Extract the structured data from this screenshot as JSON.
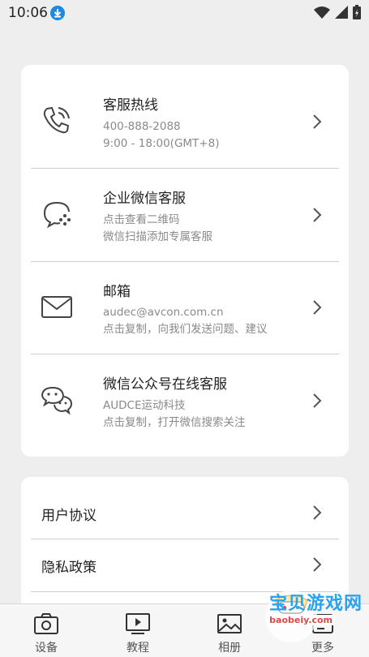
{
  "status_bar": {
    "time": "10:06"
  },
  "contact_card": {
    "items": [
      {
        "title": "客服热线",
        "line1": "400-888-2088",
        "line2": "9:00 - 18:00(GMT+8)",
        "icon": "phone-icon"
      },
      {
        "title": "企业微信客服",
        "line1": "点击查看二维码",
        "line2": "微信扫描添加专属客服",
        "icon": "wecom-icon"
      },
      {
        "title": "邮箱",
        "line1": "audec@avcon.com.cn",
        "line2": "点击复制，向我们发送问题、建议",
        "icon": "mail-icon"
      },
      {
        "title": "微信公众号在线客服",
        "line1": "AUDCE运动科技",
        "line2": "点击复制，打开微信搜索关注",
        "icon": "wechat-icon"
      }
    ]
  },
  "links_card": {
    "items": [
      {
        "title": "用户协议"
      },
      {
        "title": "隐私政策"
      }
    ]
  },
  "tabbar": {
    "tabs": [
      {
        "label": "设备",
        "icon": "camera-icon"
      },
      {
        "label": "教程",
        "icon": "play-icon"
      },
      {
        "label": "相册",
        "icon": "image-icon"
      },
      {
        "label": "更多",
        "icon": "more-icon"
      }
    ]
  },
  "watermark": {
    "text": "宝贝游戏网",
    "sub": "baobeiy.com"
  },
  "colors": {
    "background": "#eeeeee",
    "card": "#ffffff",
    "accent": "#1e88e5"
  }
}
